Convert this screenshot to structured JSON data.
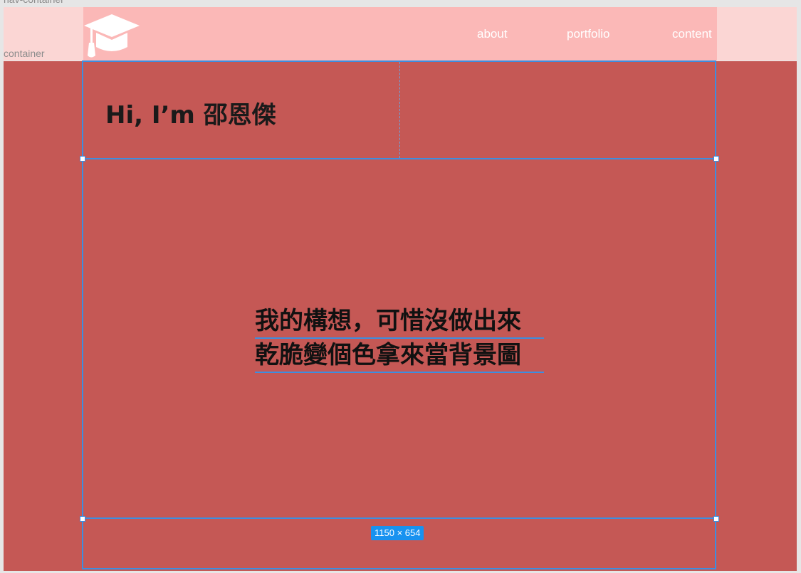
{
  "frames": {
    "nav_label": "nav-container",
    "container_label": "container"
  },
  "nav": {
    "links": [
      "about",
      "portfolio",
      "content"
    ],
    "logo_icon": "graduation-cap-icon"
  },
  "hero": {
    "title": "Hi, I’m  邵恩傑"
  },
  "main": {
    "lines": [
      "我的構想，可惜沒做出來",
      "乾脆變個色拿來當背景圖"
    ]
  },
  "selection": {
    "size_label": "1150 × 654"
  },
  "colors": {
    "nav_outer": "#fbd6d4",
    "nav_inner": "#fbb8b7",
    "main_bg": "#c55855",
    "selection": "#3d8ee0",
    "badge": "#1892f0"
  }
}
